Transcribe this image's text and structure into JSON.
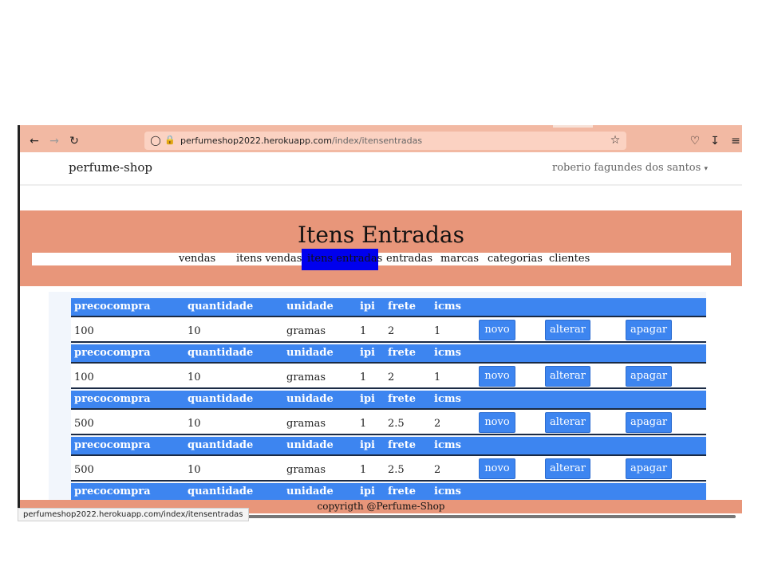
{
  "browser": {
    "url_domain": "perfumeshop2022.herokuapp.com",
    "url_path": "/index/itensentradas",
    "status_url": "perfumeshop2022.herokuapp.com/index/itensentradas"
  },
  "navbar": {
    "brand": "perfume-shop",
    "user": "roberio fagundes dos santos"
  },
  "page": {
    "title": "Itens Entradas"
  },
  "menu": {
    "items": [
      {
        "label": "vendas"
      },
      {
        "label": "itens vendas"
      },
      {
        "label": "itens entradas",
        "active": true
      },
      {
        "label": "entradas"
      },
      {
        "label": "marcas"
      },
      {
        "label": "categorias"
      },
      {
        "label": "clientes"
      }
    ]
  },
  "table": {
    "columns": [
      "precocompra",
      "quantidade",
      "unidade",
      "ipi",
      "frete",
      "icms"
    ],
    "buttons": {
      "novo": "novo",
      "alterar": "alterar",
      "apagar": "apagar"
    },
    "rows": [
      {
        "precocompra": "100",
        "quantidade": "10",
        "unidade": "gramas",
        "ipi": "1",
        "frete": "2",
        "icms": "1"
      },
      {
        "precocompra": "100",
        "quantidade": "10",
        "unidade": "gramas",
        "ipi": "1",
        "frete": "2",
        "icms": "1"
      },
      {
        "precocompra": "500",
        "quantidade": "10",
        "unidade": "gramas",
        "ipi": "1",
        "frete": "2.5",
        "icms": "2"
      },
      {
        "precocompra": "500",
        "quantidade": "10",
        "unidade": "gramas",
        "ipi": "1",
        "frete": "2.5",
        "icms": "2"
      }
    ]
  },
  "footer": {
    "text": "copyrigth @Perfume-Shop"
  },
  "colors": {
    "salmon": "#e8967a",
    "browser_chrome": "#f2b9a3",
    "header_blue": "#3d85f0",
    "active_menu": "#0000ee"
  }
}
